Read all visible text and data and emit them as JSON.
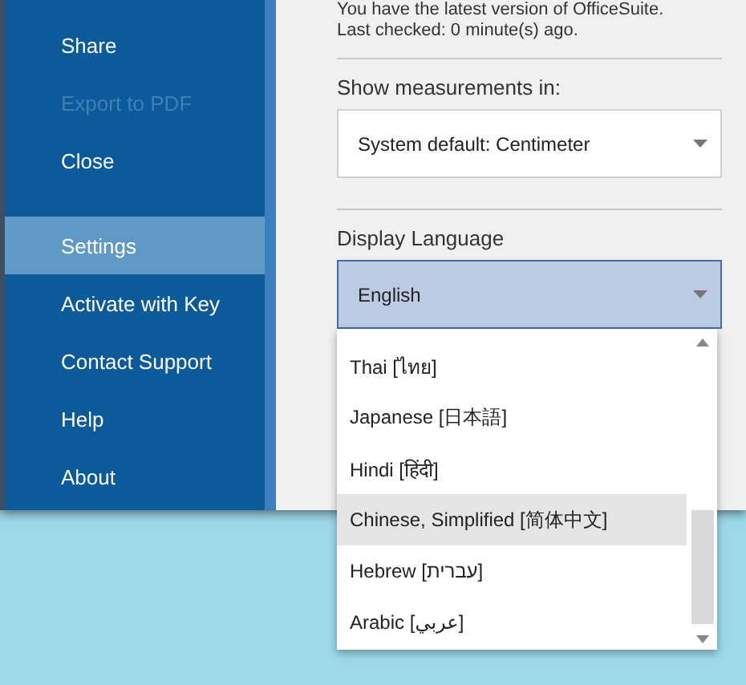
{
  "sidebar": {
    "groups": [
      [
        {
          "label": "Share",
          "disabled": false,
          "selected": false
        },
        {
          "label": "Export to PDF",
          "disabled": true,
          "selected": false
        },
        {
          "label": "Close",
          "disabled": false,
          "selected": false
        }
      ],
      [
        {
          "label": "Settings",
          "disabled": false,
          "selected": true
        },
        {
          "label": "Activate with Key",
          "disabled": false,
          "selected": false
        },
        {
          "label": "Contact Support",
          "disabled": false,
          "selected": false
        },
        {
          "label": "Help",
          "disabled": false,
          "selected": false
        },
        {
          "label": "About",
          "disabled": false,
          "selected": false
        }
      ]
    ]
  },
  "update_status": [
    "You have the latest version of OfficeSuite.",
    "Last checked: 0 minute(s) ago."
  ],
  "measurements": {
    "label": "Show measurements in:",
    "value": "System default: Centimeter"
  },
  "language": {
    "label": "Display Language",
    "value": "English",
    "expanded": true,
    "options": [
      {
        "label": "Thai [ไทย]",
        "highlighted": false
      },
      {
        "label": "Japanese [日本語]",
        "highlighted": false
      },
      {
        "label": "Hindi [हिंदी]",
        "highlighted": false
      },
      {
        "label": "Chinese, Simplified [简体中文]",
        "highlighted": true
      },
      {
        "label": "Hebrew [עברית]",
        "highlighted": false
      },
      {
        "label": "Arabic [عربي]",
        "highlighted": false
      }
    ]
  }
}
